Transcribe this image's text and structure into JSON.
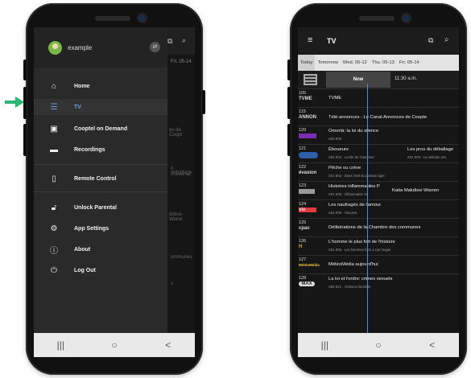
{
  "left_phone": {
    "account": {
      "username": "example"
    },
    "background": {
      "date_fragment": "Fri. 05-14",
      "texts": [
        "es de Coopt",
        "u déballage",
        "e mélodie des",
        "ddissi-Warre",
        "ommunes",
        "s"
      ]
    },
    "menu": [
      {
        "label": "Home",
        "icon": "home-icon"
      },
      {
        "label": "TV",
        "icon": "tv-guide-icon",
        "active": true
      },
      {
        "label": "Cooptel on Demand",
        "icon": "on-demand-icon"
      },
      {
        "label": "Recordings",
        "icon": "recordings-icon"
      },
      {
        "label": "Remote Control",
        "icon": "remote-control-icon"
      },
      {
        "label": "Unlock Parental",
        "icon": "unlock-icon"
      },
      {
        "label": "App Settings",
        "icon": "gear-icon"
      },
      {
        "label": "About",
        "icon": "info-icon"
      },
      {
        "label": "Log Out",
        "icon": "power-icon"
      }
    ],
    "navbar": [
      "|||",
      "○",
      "<"
    ]
  },
  "right_phone": {
    "title": "TV",
    "tabs": [
      {
        "label": "Today",
        "active": true
      },
      {
        "label": "Tomorrow"
      },
      {
        "label": "Wed. 05-12"
      },
      {
        "label": "Thu. 05-13"
      },
      {
        "label": "Fri. 05-14"
      }
    ],
    "now_label": "Now",
    "time_label": "11:30 a.m.",
    "rows": [
      {
        "channel": "105",
        "logo": "TVME",
        "programs": [
          {
            "title": "TVME",
            "sub": ""
          }
        ]
      },
      {
        "channel": "115",
        "logo": "ANNON",
        "programs": [
          {
            "title": "Télé-annonces - Le Canal Annonces de Coopte",
            "sub": ""
          }
        ]
      },
      {
        "channel": "120",
        "logo": "",
        "programs": [
          {
            "title": "Omertà: la loi du silence",
            "sub": "S03 E05"
          }
        ]
      },
      {
        "channel": "121",
        "logo": "",
        "programs": [
          {
            "title": "Éboueurs",
            "sub": "S02 E04 · Lenfer de l'automne"
          },
          {
            "title": "Les pros du déballage",
            "sub": "S01 E05 · La mélodie des"
          }
        ]
      },
      {
        "channel": "122",
        "logo": "évasion",
        "programs": [
          {
            "title": "Pêche ou crève",
            "sub": "S01 E02 · Dans l'oeil du poisson tigre"
          }
        ]
      },
      {
        "channel": "123",
        "logo": "",
        "programs": [
          {
            "title": "Histoires inflammables P",
            "sub": "S01 E06 · Inflammatoir S0"
          },
          {
            "title": "Katia Makdissi-Warren",
            "sub": ""
          }
        ]
      },
      {
        "channel": "124",
        "logo": "vie",
        "programs": [
          {
            "title": "Les naufragés de l'amour",
            "sub": "S02 E08 · Toscano"
          }
        ]
      },
      {
        "channel": "125",
        "logo": "cpac",
        "programs": [
          {
            "title": "Délibérations de la Chambre des communes",
            "sub": ""
          }
        ]
      },
      {
        "channel": "126",
        "logo": "H",
        "programs": [
          {
            "title": "L'homme le plus fort de l'histoire",
            "sub": "S01 E06 · Les hommes forts à Las Vegas"
          }
        ]
      },
      {
        "channel": "127",
        "logo": "MétéoMédia",
        "programs": [
          {
            "title": "MétéoMédia aujourd'hui",
            "sub": ""
          }
        ]
      },
      {
        "channel": "128",
        "logo": "MAX",
        "programs": [
          {
            "title": "La loi et l'ordre: crimes sexuels",
            "sub": "S06 E21 · Violence familiale"
          }
        ]
      }
    ],
    "navbar": [
      "|||",
      "○",
      "<"
    ]
  },
  "colors": {
    "accent": "#4a8fd8",
    "arrow": "#2bb673"
  }
}
